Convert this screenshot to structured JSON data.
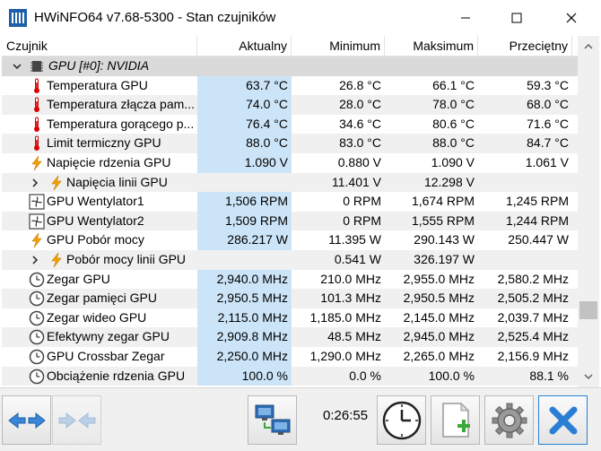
{
  "window": {
    "title": "HWiNFO64 v7.68-5300 - Stan czujników"
  },
  "columns": [
    "Czujnik",
    "Aktualny",
    "Minimum",
    "Maksimum",
    "Przeciętny"
  ],
  "group": {
    "label": "GPU [#0]: NVIDIA"
  },
  "rows": [
    {
      "name": "Temperatura GPU",
      "current": "63.7 °C",
      "min": "26.8 °C",
      "max": "66.1 °C",
      "avg": "59.3 °C",
      "icon": "thermometer-icon"
    },
    {
      "name": "Temperatura złącza pam...",
      "current": "74.0 °C",
      "min": "28.0 °C",
      "max": "78.0 °C",
      "avg": "68.0 °C",
      "icon": "thermometer-icon"
    },
    {
      "name": "Temperatura gorącego p...",
      "current": "76.4 °C",
      "min": "34.6 °C",
      "max": "80.6 °C",
      "avg": "71.6 °C",
      "icon": "thermometer-icon"
    },
    {
      "name": "Limit termiczny GPU",
      "current": "88.0 °C",
      "min": "83.0 °C",
      "max": "88.0 °C",
      "avg": "84.7 °C",
      "icon": "thermometer-icon"
    },
    {
      "name": "Napięcie rdzenia GPU",
      "current": "1.090 V",
      "min": "0.880 V",
      "max": "1.090 V",
      "avg": "1.061 V",
      "icon": "lightning-icon"
    },
    {
      "name": "Napięcia linii GPU",
      "current": "",
      "min": "11.401 V",
      "max": "12.298 V",
      "avg": "",
      "icon": "lightning-icon",
      "sub": true
    },
    {
      "name": "GPU Wentylator1",
      "current": "1,506 RPM",
      "min": "0 RPM",
      "max": "1,674 RPM",
      "avg": "1,245 RPM",
      "icon": "fan-icon"
    },
    {
      "name": "GPU Wentylator2",
      "current": "1,509 RPM",
      "min": "0 RPM",
      "max": "1,555 RPM",
      "avg": "1,244 RPM",
      "icon": "fan-icon"
    },
    {
      "name": "GPU Pobór mocy",
      "current": "286.217 W",
      "min": "11.395 W",
      "max": "290.143 W",
      "avg": "250.447 W",
      "icon": "lightning-icon"
    },
    {
      "name": "Pobór mocy linii GPU",
      "current": "",
      "min": "0.541 W",
      "max": "326.197 W",
      "avg": "",
      "icon": "lightning-icon",
      "sub": true
    },
    {
      "name": "Zegar GPU",
      "current": "2,940.0 MHz",
      "min": "210.0 MHz",
      "max": "2,955.0 MHz",
      "avg": "2,580.2 MHz",
      "icon": "clock-icon"
    },
    {
      "name": "Zegar pamięci GPU",
      "current": "2,950.5 MHz",
      "min": "101.3 MHz",
      "max": "2,950.5 MHz",
      "avg": "2,505.2 MHz",
      "icon": "clock-icon"
    },
    {
      "name": "Zegar wideo GPU",
      "current": "2,115.0 MHz",
      "min": "1,185.0 MHz",
      "max": "2,145.0 MHz",
      "avg": "2,039.7 MHz",
      "icon": "clock-icon"
    },
    {
      "name": "Efektywny zegar GPU",
      "current": "2,909.8 MHz",
      "min": "48.5 MHz",
      "max": "2,945.0 MHz",
      "avg": "2,525.4 MHz",
      "icon": "clock-icon"
    },
    {
      "name": "GPU Crossbar Zegar",
      "current": "2,250.0 MHz",
      "min": "1,290.0 MHz",
      "max": "2,265.0 MHz",
      "avg": "2,156.9 MHz",
      "icon": "clock-icon"
    },
    {
      "name": "Obciążenie rdzenia GPU",
      "current": "100.0 %",
      "min": "0.0 %",
      "max": "100.0 %",
      "avg": "88.1 %",
      "icon": "clock-icon"
    }
  ],
  "toolbar": {
    "timer": "0:26:55"
  },
  "colors": {
    "highlight": "#cce4f7",
    "group_bg": "#dadada",
    "accent": "#2a7fd4"
  }
}
